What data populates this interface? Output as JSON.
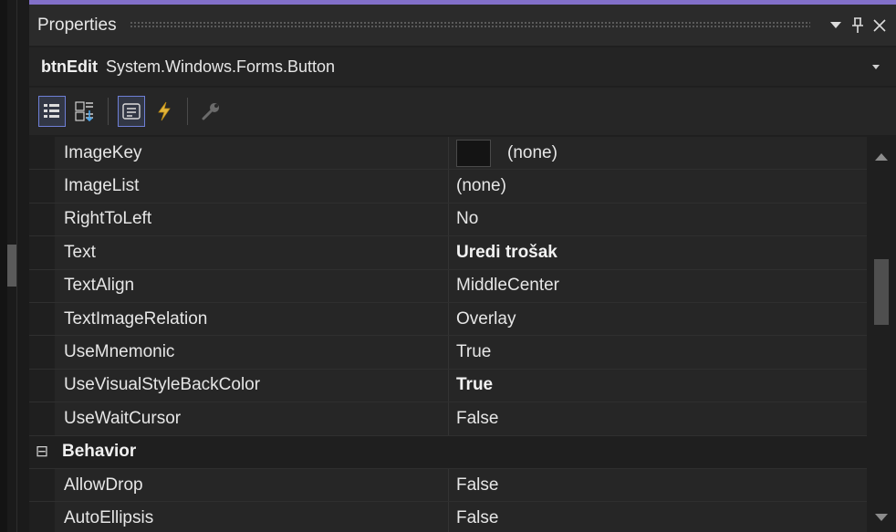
{
  "panel": {
    "title": "Properties",
    "dropdown_icon": "chevron-down-icon",
    "pin_icon": "pin-icon",
    "close_icon": "close-icon"
  },
  "object_selector": {
    "name": "btnEdit",
    "type": "System.Windows.Forms.Button"
  },
  "toolbar": {
    "buttons": [
      {
        "icon": "categorized-icon",
        "active": true
      },
      {
        "icon": "alphabetical-icon",
        "active": false
      },
      {
        "icon": "properties-icon",
        "active": true
      },
      {
        "icon": "events-lightning-icon",
        "active": false
      },
      {
        "icon": "property-pages-wrench-icon",
        "active": false
      }
    ]
  },
  "rows": [
    {
      "name": "ImageKey",
      "value": "(none)",
      "bold": false,
      "swatch": true
    },
    {
      "name": "ImageList",
      "value": "(none)",
      "bold": false
    },
    {
      "name": "RightToLeft",
      "value": "No",
      "bold": false
    },
    {
      "name": "Text",
      "value": "Uredi trošak",
      "bold": true
    },
    {
      "name": "TextAlign",
      "value": "MiddleCenter",
      "bold": false
    },
    {
      "name": "TextImageRelation",
      "value": "Overlay",
      "bold": false
    },
    {
      "name": "UseMnemonic",
      "value": "True",
      "bold": false
    },
    {
      "name": "UseVisualStyleBackColor",
      "value": "True",
      "bold": true
    },
    {
      "name": "UseWaitCursor",
      "value": "False",
      "bold": false
    }
  ],
  "category": {
    "label": "Behavior",
    "toggle": "⊟"
  },
  "behavior_rows": [
    {
      "name": "AllowDrop",
      "value": "False",
      "bold": false
    },
    {
      "name": "AutoEllipsis",
      "value": "False",
      "bold": false
    }
  ],
  "colors": {
    "accent": "#8270c9",
    "background": "#1f1f1f",
    "row_background": "#262626",
    "text": "#e6e6e6"
  }
}
